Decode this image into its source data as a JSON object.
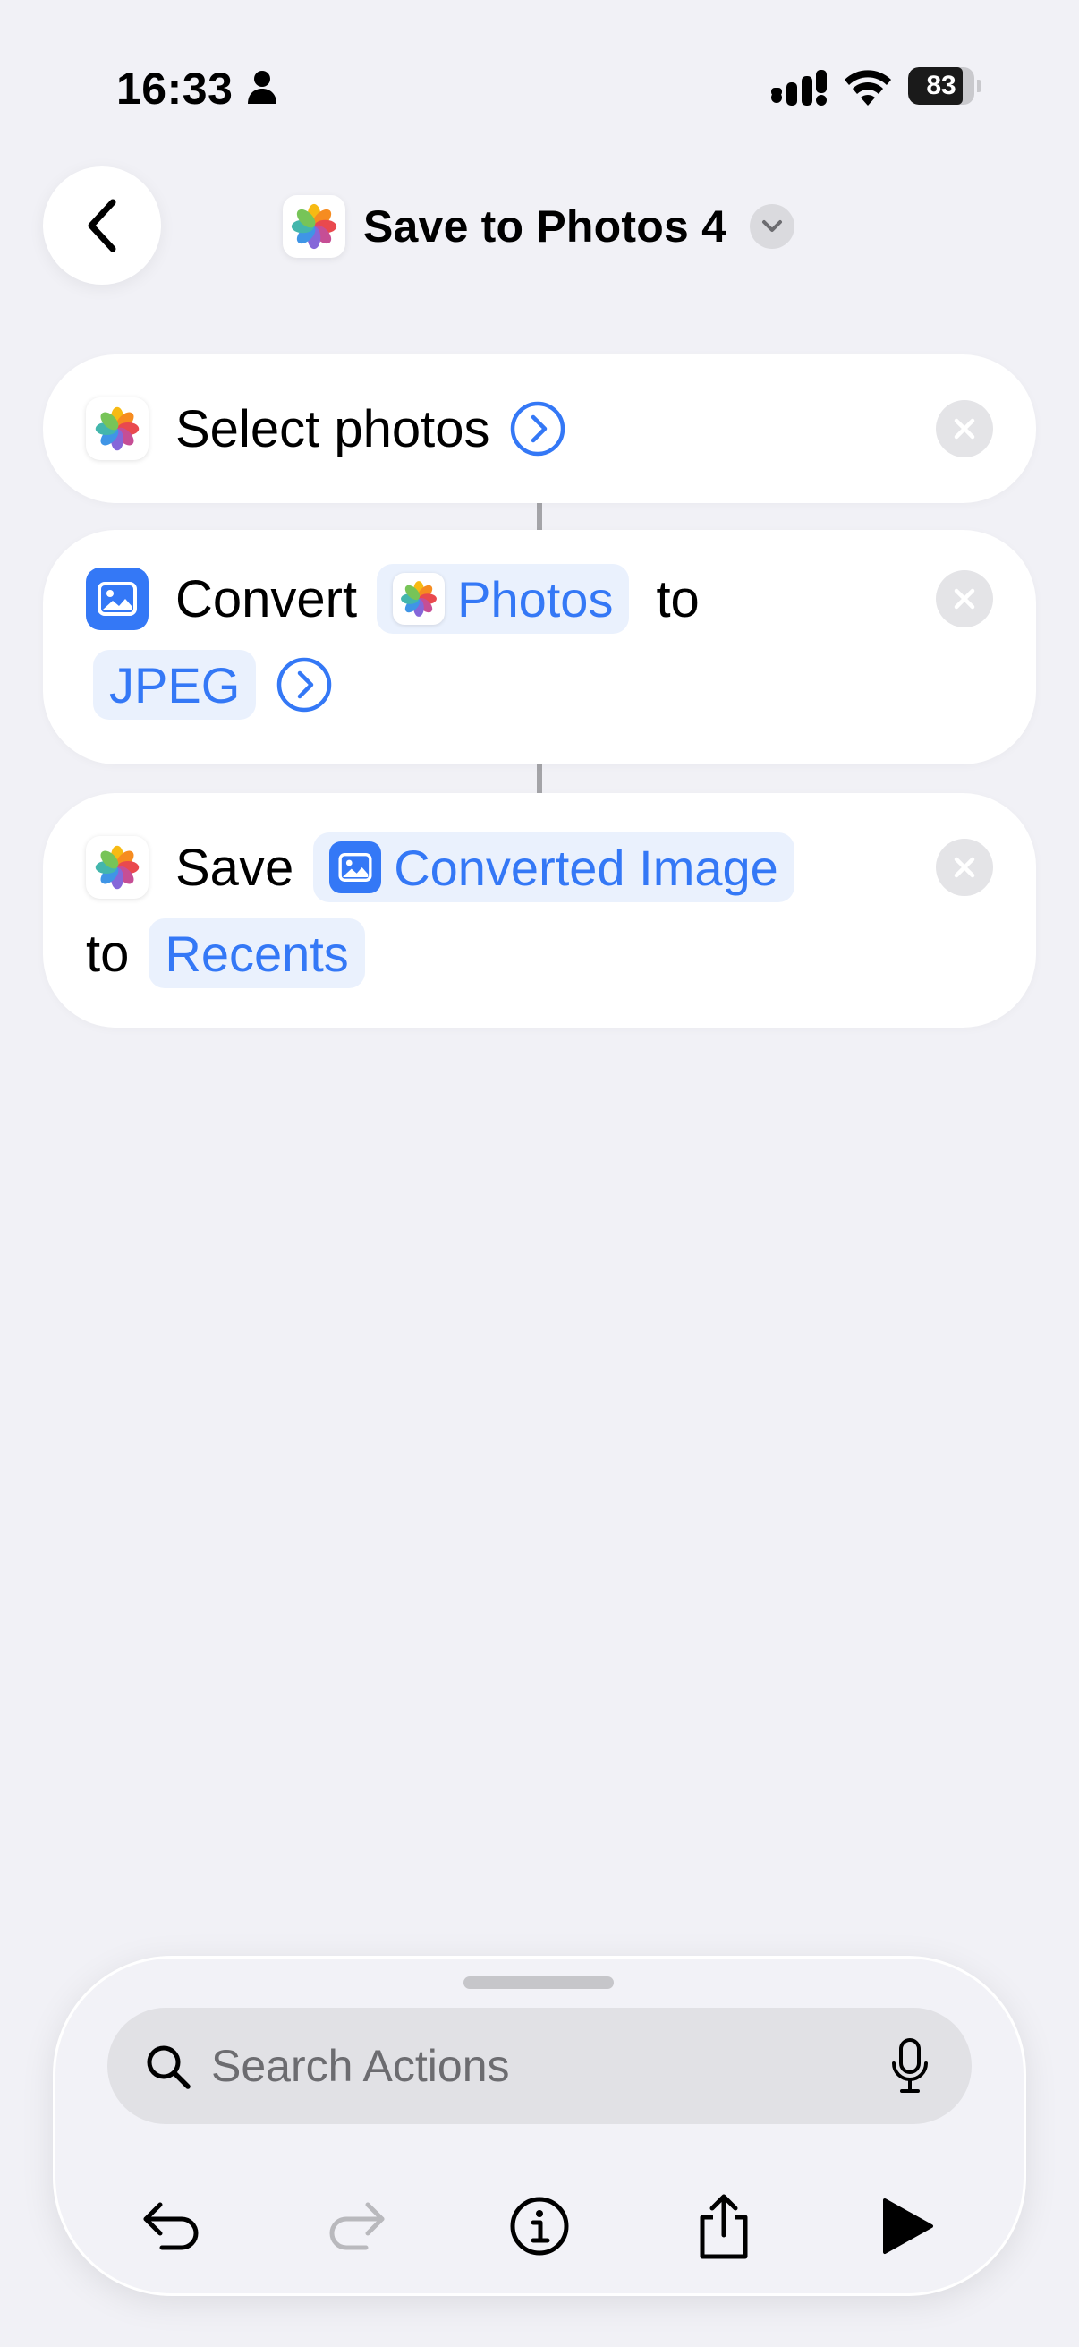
{
  "status_bar": {
    "time": "16:33",
    "battery_level": "83",
    "battery_fraction": 0.83,
    "icons": [
      "person-icon",
      "cellular-signal-icon",
      "wifi-icon",
      "battery-icon"
    ]
  },
  "header": {
    "back_icon": "chevron-left-icon",
    "app_icon": "photos-app-icon",
    "title": "Save to Photos 4",
    "title_menu_icon": "chevron-down-icon"
  },
  "actions": [
    {
      "icon": "photos-app-icon",
      "verb": "Select photos",
      "expand_icon": "chevron-right-circle-icon",
      "remove_icon": "close-icon"
    },
    {
      "icon": "image-icon",
      "verb": "Convert",
      "input_token": "Photos",
      "input_token_icon": "photos-app-icon",
      "connector": "to",
      "format_token": "JPEG",
      "expand_icon": "chevron-right-circle-icon",
      "remove_icon": "close-icon"
    },
    {
      "icon": "photos-app-icon",
      "verb": "Save",
      "input_token": "Converted Image",
      "input_token_icon": "image-icon",
      "connector": "to",
      "album_token": "Recents",
      "remove_icon": "close-icon"
    }
  ],
  "bottom_panel": {
    "search": {
      "placeholder": "Search Actions",
      "value": "",
      "icon": "search-icon",
      "mic_icon": "microphone-icon"
    },
    "toolbar": [
      "undo-icon",
      "redo-icon",
      "info-icon",
      "share-icon",
      "play-icon"
    ]
  },
  "colors": {
    "background": "#f1f1f6",
    "accent_blue": "#3478f6",
    "token_background": "#eaf1fd",
    "card_background": "#ffffff"
  }
}
